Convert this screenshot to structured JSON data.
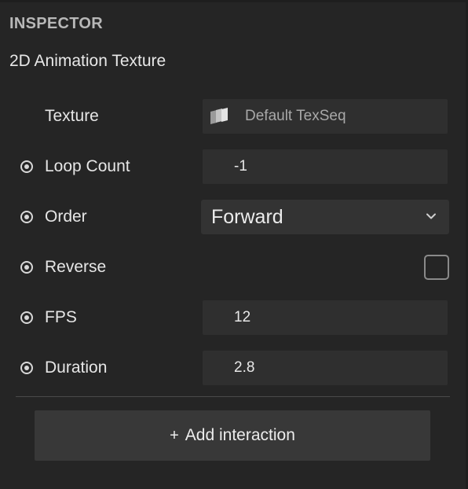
{
  "panel": {
    "title": "INSPECTOR"
  },
  "component": {
    "title": "2D Animation Texture"
  },
  "properties": {
    "texture": {
      "label": "Texture",
      "value": "Default TexSeq",
      "icon": "texture-sequence-icon"
    },
    "loop_count": {
      "label": "Loop Count",
      "value": "-1"
    },
    "order": {
      "label": "Order",
      "value": "Forward"
    },
    "reverse": {
      "label": "Reverse",
      "checked": false
    },
    "fps": {
      "label": "FPS",
      "value": "12"
    },
    "duration": {
      "label": "Duration",
      "value": "2.8"
    }
  },
  "actions": {
    "add_interaction_label": "Add interaction",
    "add_icon": "+"
  },
  "colors": {
    "background": "#252525",
    "field": "#2f2f2f",
    "button": "#383838",
    "text": "#e6e6e6"
  }
}
